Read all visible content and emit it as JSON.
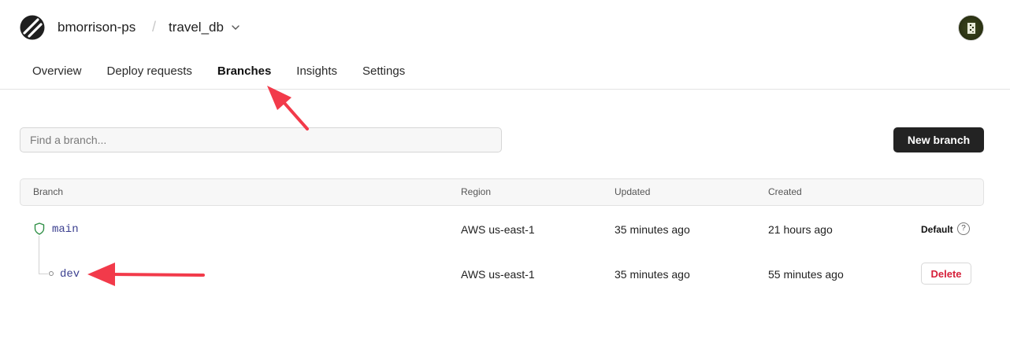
{
  "header": {
    "org": "bmorrison-ps",
    "separator": "/",
    "database": "travel_db",
    "icons": {
      "logo": "planetscale-logo-icon",
      "dropdown": "chevron-down-icon",
      "avatar": "user-avatar"
    },
    "colors": {
      "accent": "#3b82c4",
      "primary_button": "#232323",
      "danger": "#d6203a",
      "branch_link": "#3b3f8f",
      "annotation_arrow": "#f23a4a"
    }
  },
  "tabs": [
    {
      "label": "Overview"
    },
    {
      "label": "Deploy requests"
    },
    {
      "label": "Branches",
      "active": true
    },
    {
      "label": "Insights"
    },
    {
      "label": "Settings"
    }
  ],
  "search": {
    "placeholder": "Find a branch...",
    "value": ""
  },
  "new_branch_label": "New branch",
  "table": {
    "columns": [
      "Branch",
      "Region",
      "Updated",
      "Created"
    ],
    "rows": [
      {
        "branch": "main",
        "region": "AWS us-east-1",
        "updated": "35 minutes ago",
        "created": "21 hours ago",
        "status": "Default",
        "help": "?"
      },
      {
        "branch": "dev",
        "region": "AWS us-east-1",
        "updated": "35 minutes ago",
        "created": "55 minutes ago",
        "action": "Delete"
      }
    ]
  }
}
